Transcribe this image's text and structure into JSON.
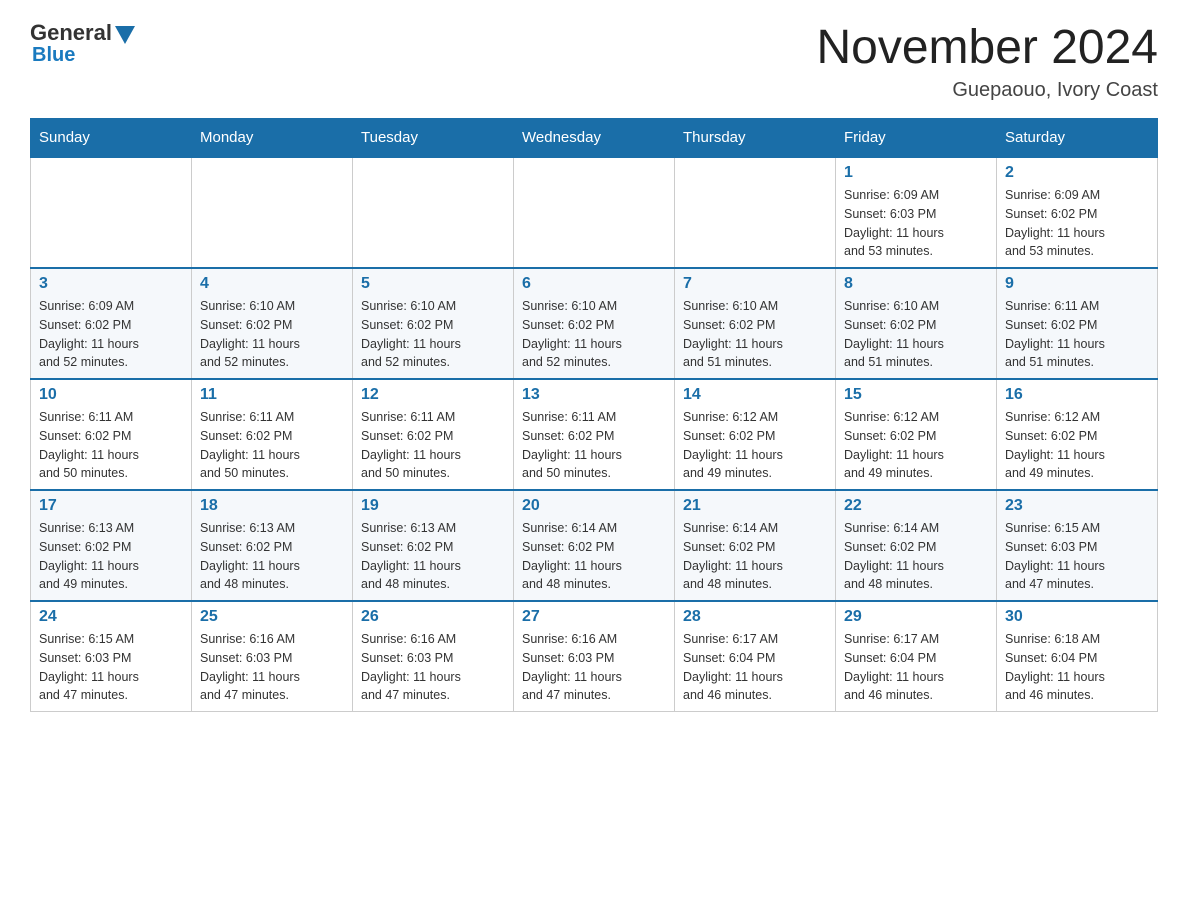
{
  "logo": {
    "text_general": "General",
    "text_blue": "Blue"
  },
  "title": "November 2024",
  "subtitle": "Guepaouo, Ivory Coast",
  "days_of_week": [
    "Sunday",
    "Monday",
    "Tuesday",
    "Wednesday",
    "Thursday",
    "Friday",
    "Saturday"
  ],
  "weeks": [
    [
      {
        "day": "",
        "info": ""
      },
      {
        "day": "",
        "info": ""
      },
      {
        "day": "",
        "info": ""
      },
      {
        "day": "",
        "info": ""
      },
      {
        "day": "",
        "info": ""
      },
      {
        "day": "1",
        "info": "Sunrise: 6:09 AM\nSunset: 6:03 PM\nDaylight: 11 hours\nand 53 minutes."
      },
      {
        "day": "2",
        "info": "Sunrise: 6:09 AM\nSunset: 6:02 PM\nDaylight: 11 hours\nand 53 minutes."
      }
    ],
    [
      {
        "day": "3",
        "info": "Sunrise: 6:09 AM\nSunset: 6:02 PM\nDaylight: 11 hours\nand 52 minutes."
      },
      {
        "day": "4",
        "info": "Sunrise: 6:10 AM\nSunset: 6:02 PM\nDaylight: 11 hours\nand 52 minutes."
      },
      {
        "day": "5",
        "info": "Sunrise: 6:10 AM\nSunset: 6:02 PM\nDaylight: 11 hours\nand 52 minutes."
      },
      {
        "day": "6",
        "info": "Sunrise: 6:10 AM\nSunset: 6:02 PM\nDaylight: 11 hours\nand 52 minutes."
      },
      {
        "day": "7",
        "info": "Sunrise: 6:10 AM\nSunset: 6:02 PM\nDaylight: 11 hours\nand 51 minutes."
      },
      {
        "day": "8",
        "info": "Sunrise: 6:10 AM\nSunset: 6:02 PM\nDaylight: 11 hours\nand 51 minutes."
      },
      {
        "day": "9",
        "info": "Sunrise: 6:11 AM\nSunset: 6:02 PM\nDaylight: 11 hours\nand 51 minutes."
      }
    ],
    [
      {
        "day": "10",
        "info": "Sunrise: 6:11 AM\nSunset: 6:02 PM\nDaylight: 11 hours\nand 50 minutes."
      },
      {
        "day": "11",
        "info": "Sunrise: 6:11 AM\nSunset: 6:02 PM\nDaylight: 11 hours\nand 50 minutes."
      },
      {
        "day": "12",
        "info": "Sunrise: 6:11 AM\nSunset: 6:02 PM\nDaylight: 11 hours\nand 50 minutes."
      },
      {
        "day": "13",
        "info": "Sunrise: 6:11 AM\nSunset: 6:02 PM\nDaylight: 11 hours\nand 50 minutes."
      },
      {
        "day": "14",
        "info": "Sunrise: 6:12 AM\nSunset: 6:02 PM\nDaylight: 11 hours\nand 49 minutes."
      },
      {
        "day": "15",
        "info": "Sunrise: 6:12 AM\nSunset: 6:02 PM\nDaylight: 11 hours\nand 49 minutes."
      },
      {
        "day": "16",
        "info": "Sunrise: 6:12 AM\nSunset: 6:02 PM\nDaylight: 11 hours\nand 49 minutes."
      }
    ],
    [
      {
        "day": "17",
        "info": "Sunrise: 6:13 AM\nSunset: 6:02 PM\nDaylight: 11 hours\nand 49 minutes."
      },
      {
        "day": "18",
        "info": "Sunrise: 6:13 AM\nSunset: 6:02 PM\nDaylight: 11 hours\nand 48 minutes."
      },
      {
        "day": "19",
        "info": "Sunrise: 6:13 AM\nSunset: 6:02 PM\nDaylight: 11 hours\nand 48 minutes."
      },
      {
        "day": "20",
        "info": "Sunrise: 6:14 AM\nSunset: 6:02 PM\nDaylight: 11 hours\nand 48 minutes."
      },
      {
        "day": "21",
        "info": "Sunrise: 6:14 AM\nSunset: 6:02 PM\nDaylight: 11 hours\nand 48 minutes."
      },
      {
        "day": "22",
        "info": "Sunrise: 6:14 AM\nSunset: 6:02 PM\nDaylight: 11 hours\nand 48 minutes."
      },
      {
        "day": "23",
        "info": "Sunrise: 6:15 AM\nSunset: 6:03 PM\nDaylight: 11 hours\nand 47 minutes."
      }
    ],
    [
      {
        "day": "24",
        "info": "Sunrise: 6:15 AM\nSunset: 6:03 PM\nDaylight: 11 hours\nand 47 minutes."
      },
      {
        "day": "25",
        "info": "Sunrise: 6:16 AM\nSunset: 6:03 PM\nDaylight: 11 hours\nand 47 minutes."
      },
      {
        "day": "26",
        "info": "Sunrise: 6:16 AM\nSunset: 6:03 PM\nDaylight: 11 hours\nand 47 minutes."
      },
      {
        "day": "27",
        "info": "Sunrise: 6:16 AM\nSunset: 6:03 PM\nDaylight: 11 hours\nand 47 minutes."
      },
      {
        "day": "28",
        "info": "Sunrise: 6:17 AM\nSunset: 6:04 PM\nDaylight: 11 hours\nand 46 minutes."
      },
      {
        "day": "29",
        "info": "Sunrise: 6:17 AM\nSunset: 6:04 PM\nDaylight: 11 hours\nand 46 minutes."
      },
      {
        "day": "30",
        "info": "Sunrise: 6:18 AM\nSunset: 6:04 PM\nDaylight: 11 hours\nand 46 minutes."
      }
    ]
  ]
}
